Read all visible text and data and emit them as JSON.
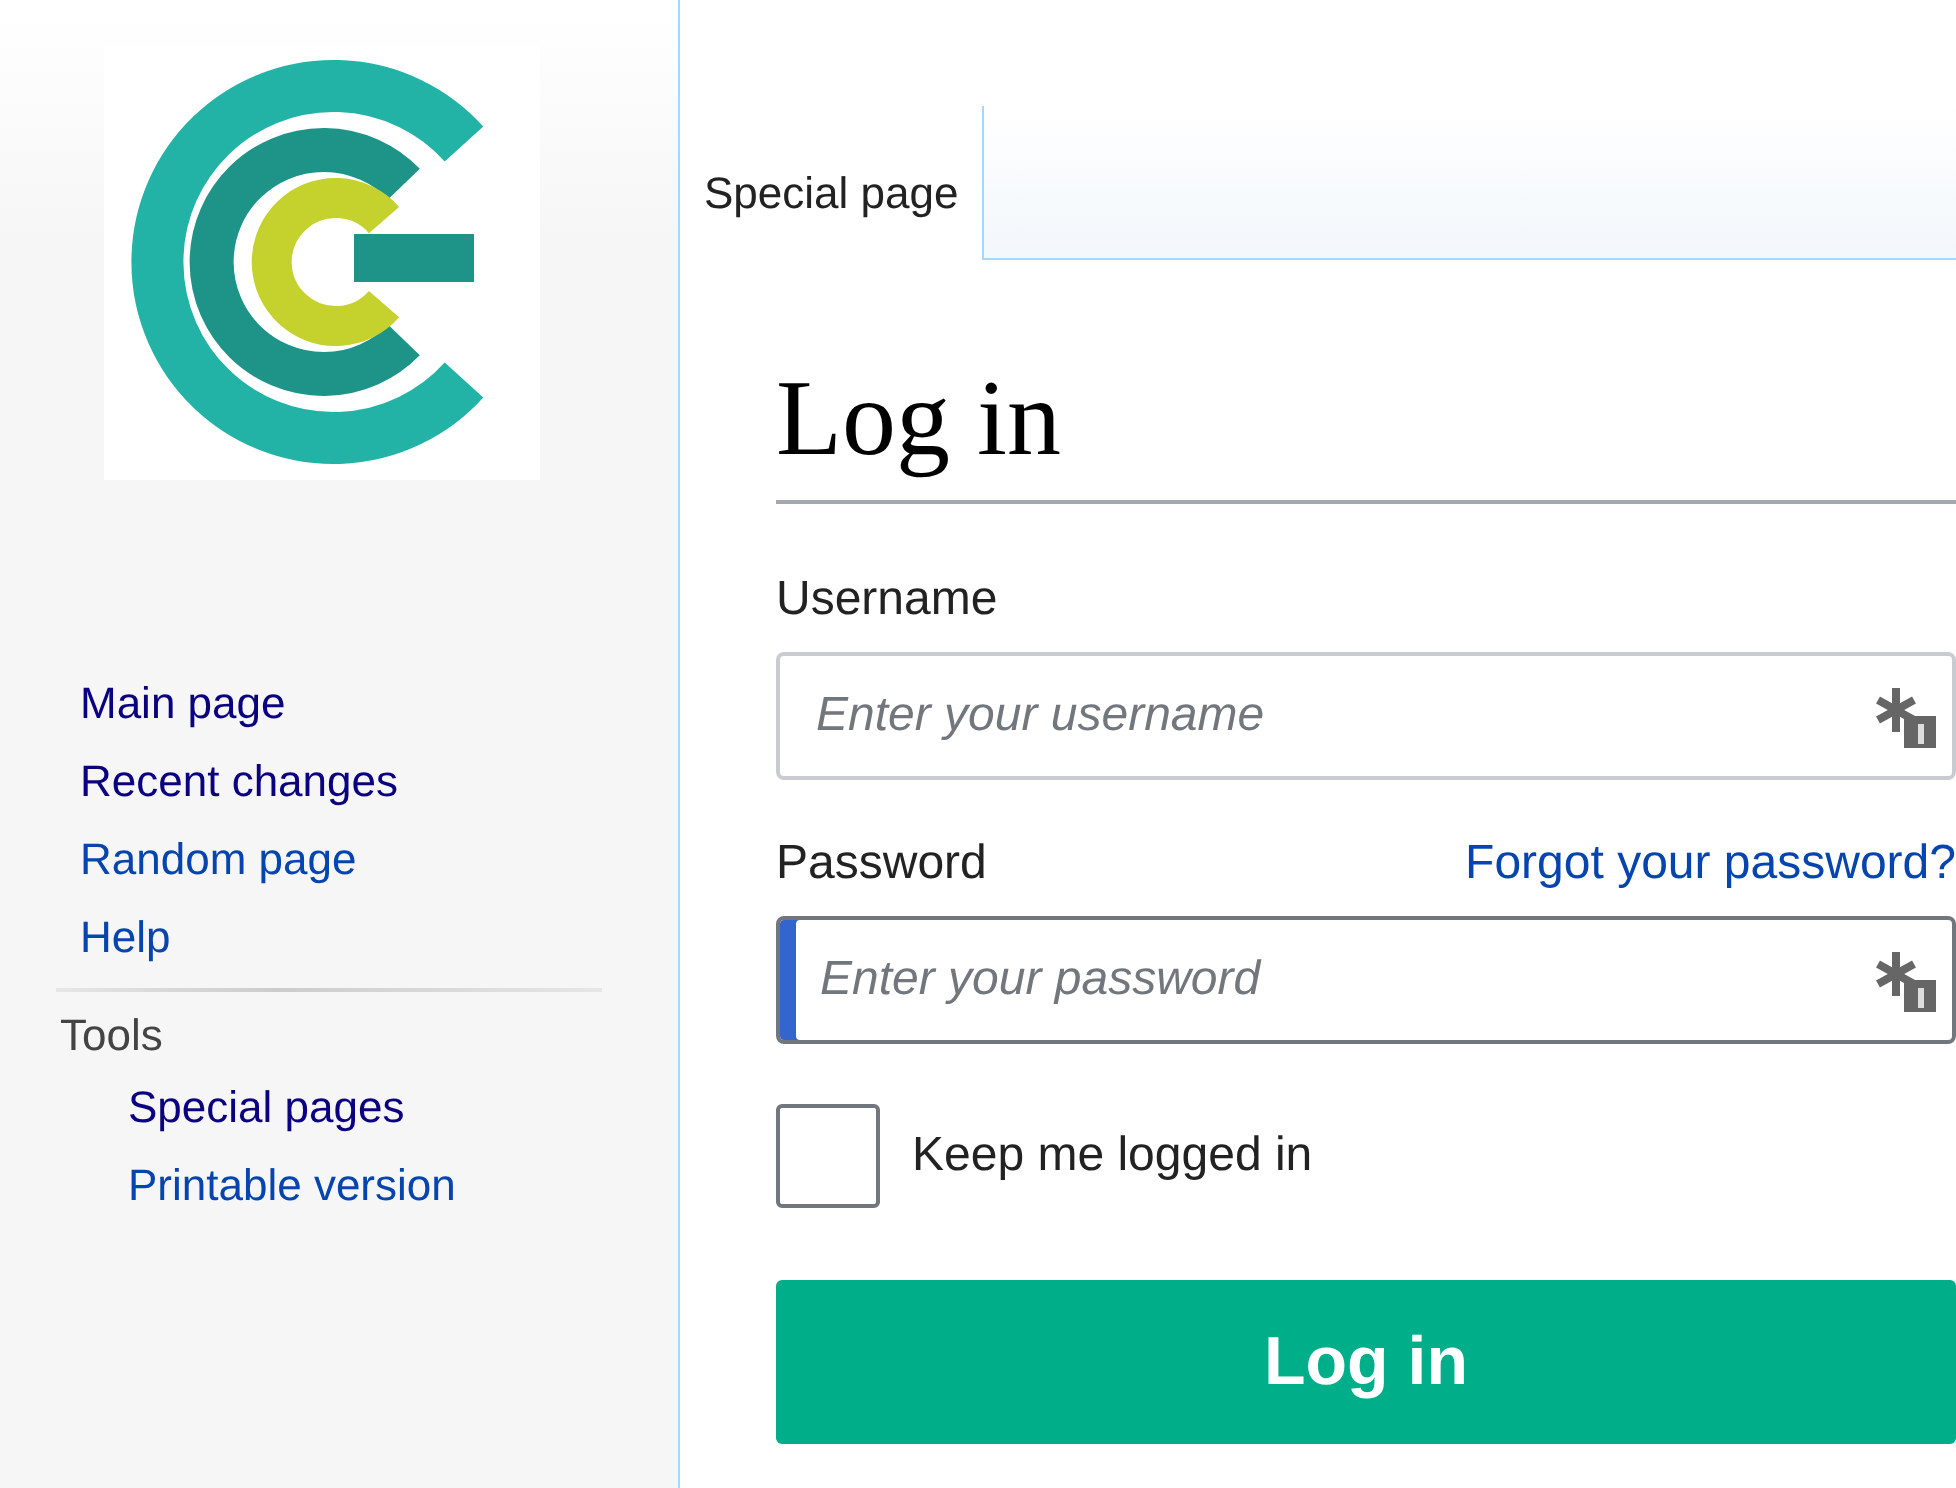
{
  "sidebar": {
    "nav": [
      {
        "label": "Main page",
        "visited": true
      },
      {
        "label": "Recent changes",
        "visited": true
      },
      {
        "label": "Random page",
        "visited": false
      },
      {
        "label": "Help",
        "visited": false
      }
    ],
    "tools": {
      "heading": "Tools",
      "items": [
        {
          "label": "Special pages",
          "visited": true
        },
        {
          "label": "Printable version",
          "visited": false
        }
      ]
    }
  },
  "tabs": [
    {
      "label": "Special page",
      "selected": true
    }
  ],
  "page": {
    "title": "Log in",
    "fields": [
      {
        "label": "Username",
        "placeholder": "Enter your username",
        "focused": false
      },
      {
        "label": "Password",
        "placeholder": "Enter your password",
        "focused": true,
        "link": "Forgot your password?"
      }
    ],
    "keep_logged_in": {
      "label": "Keep me logged in",
      "checked": false
    },
    "submit": "Log in"
  }
}
